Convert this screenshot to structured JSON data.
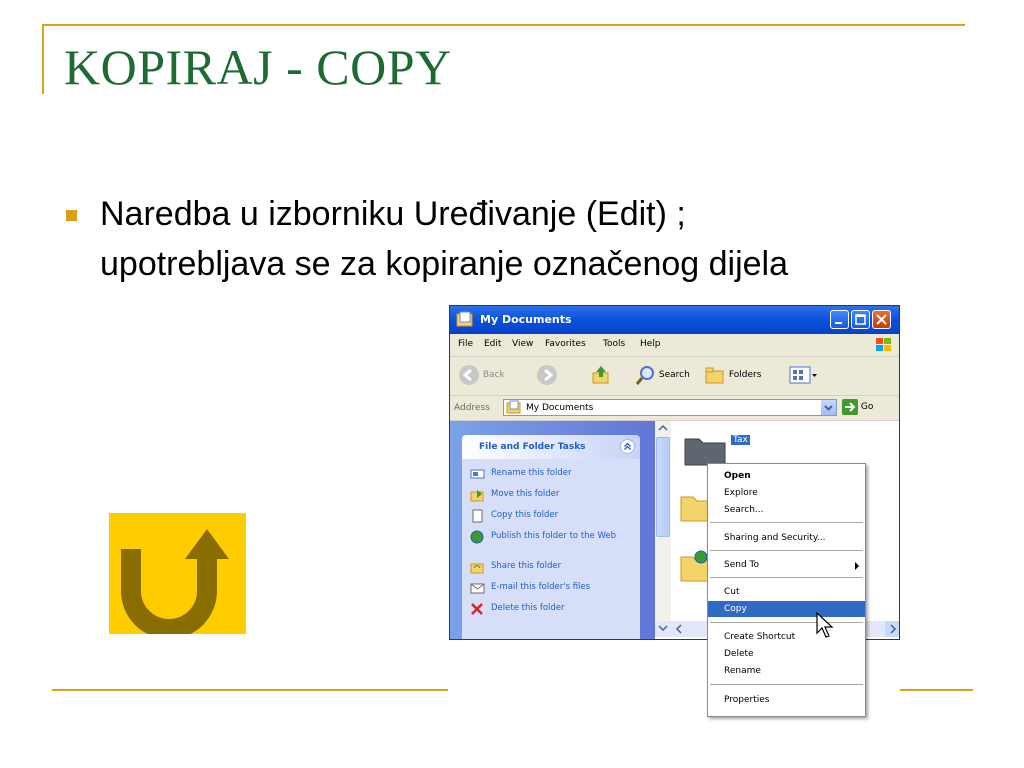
{
  "slide": {
    "title": "KOPIRAJ - COPY",
    "bullet_line1": "Naredba u izborniku Uređivanje (Edit) ;",
    "bullet_line2": "upotrebljava se za kopiranje označenog dijela"
  },
  "colors": {
    "title": "#1d6b32",
    "accent": "#d9a21b",
    "back_button": "#ffcc00",
    "back_arrow": "#8a6d00",
    "xp_blue": "#0a50dc",
    "selection": "#316ac5"
  },
  "back_button": {
    "icon": "return-arrow-icon"
  },
  "window": {
    "title": "My Documents",
    "menu": [
      "File",
      "Edit",
      "View",
      "Favorites",
      "Tools",
      "Help"
    ],
    "toolbar": {
      "back": "Back",
      "search": "Search",
      "folders": "Folders"
    },
    "address": {
      "label": "Address",
      "value": "My Documents",
      "go": "Go"
    },
    "tasks": {
      "header": "File and Folder Tasks",
      "items": [
        "Rename this folder",
        "Move this folder",
        "Copy this folder",
        "Publish this folder to the Web",
        "Share this folder",
        "E-mail this folder's files",
        "Delete this folder"
      ]
    },
    "selected_file": "Tax"
  },
  "context_menu": {
    "items": [
      {
        "label": "Open",
        "bold": true
      },
      {
        "label": "Explore"
      },
      {
        "label": "Search..."
      },
      {
        "label": "Sharing and Security..."
      },
      {
        "label": "Send To",
        "submenu": true
      },
      {
        "label": "Cut"
      },
      {
        "label": "Copy",
        "selected": true
      },
      {
        "label": "Create Shortcut"
      },
      {
        "label": "Delete"
      },
      {
        "label": "Rename"
      },
      {
        "label": "Properties"
      }
    ]
  }
}
